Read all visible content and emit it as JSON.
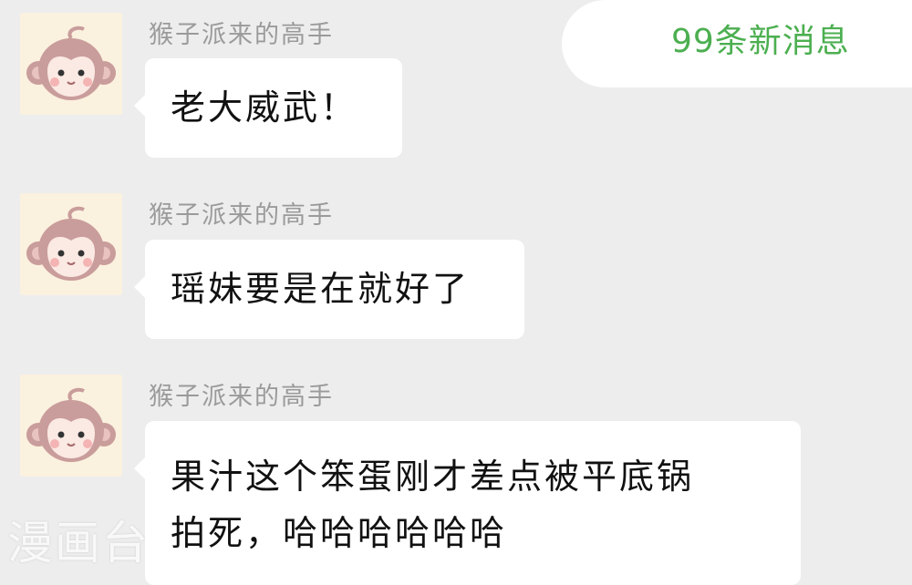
{
  "new_messages": {
    "label": "99条新消息"
  },
  "messages": [
    {
      "sender": "猴子派来的高手",
      "avatar": "monkey-avatar",
      "lines": [
        "老大威武！"
      ]
    },
    {
      "sender": "猴子派来的高手",
      "avatar": "monkey-avatar",
      "lines": [
        "瑶妹要是在就好了"
      ]
    },
    {
      "sender": "猴子派来的高手",
      "avatar": "monkey-avatar",
      "lines": [
        "果汁这个笨蛋刚才差点被平底锅",
        "拍死，哈哈哈哈哈哈"
      ]
    }
  ],
  "watermark": {
    "text": "漫画台"
  },
  "colors": {
    "background": "#ededed",
    "bubble": "#ffffff",
    "new_messages_text": "#4caf50",
    "sender_text": "#9a9a9a"
  }
}
